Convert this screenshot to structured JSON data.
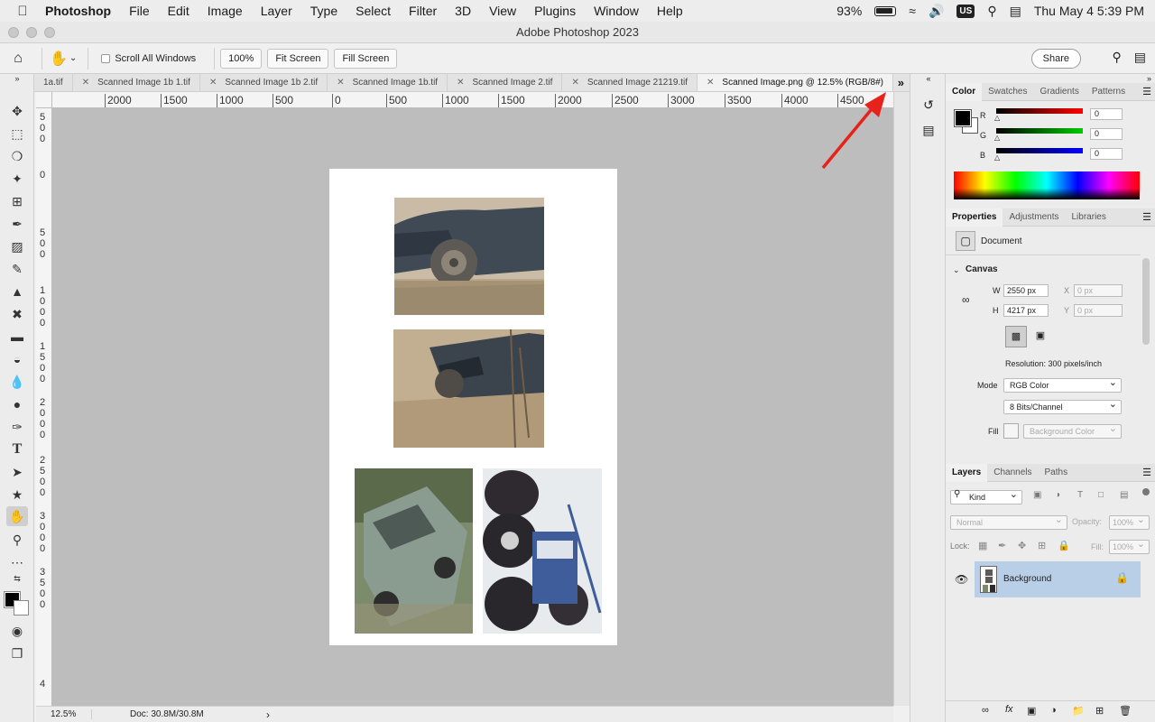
{
  "menubar": {
    "apple_icon": "apple-logo",
    "items": [
      "Photoshop",
      "File",
      "Edit",
      "Image",
      "Layer",
      "Type",
      "Select",
      "Filter",
      "3D",
      "View",
      "Plugins",
      "Window",
      "Help"
    ],
    "battery": "93%",
    "input_source": "US",
    "datetime": "Thu May 4  5:39 PM"
  },
  "window": {
    "title": "Adobe Photoshop 2023"
  },
  "options": {
    "scroll_all_label": "Scroll All Windows",
    "zoom_btn": "100%",
    "fit_screen": "Fit Screen",
    "fill_screen": "Fill Screen",
    "share": "Share"
  },
  "tabs": [
    {
      "label": "1a.tif",
      "active": false
    },
    {
      "label": "Scanned Image 1b 1.tif",
      "active": false
    },
    {
      "label": "Scanned Image 1b 2.tif",
      "active": false
    },
    {
      "label": "Scanned Image 1b.tif",
      "active": false
    },
    {
      "label": "Scanned Image 2.tif",
      "active": false
    },
    {
      "label": "Scanned Image 21219.tif",
      "active": false
    },
    {
      "label": "Scanned Image.png @ 12.5% (RGB/8#)",
      "active": true
    }
  ],
  "ruler_h": [
    "2000",
    "1500",
    "1000",
    "500",
    "0",
    "500",
    "1000",
    "1500",
    "2000",
    "2500",
    "3000",
    "3500",
    "4000",
    "4500"
  ],
  "ruler_v": [
    "500",
    "0",
    "500",
    "1000",
    "1500",
    "2000",
    "2500",
    "3000",
    "3500",
    "4"
  ],
  "status": {
    "zoom": "12.5%",
    "doc": "Doc: 30.8M/30.8M"
  },
  "color_panel": {
    "tabs": [
      "Color",
      "Swatches",
      "Gradients",
      "Patterns"
    ],
    "channels": [
      {
        "label": "R",
        "value": "0",
        "color": "#ff0000"
      },
      {
        "label": "G",
        "value": "0",
        "color": "#00cc00"
      },
      {
        "label": "B",
        "value": "0",
        "color": "#0000ff"
      }
    ]
  },
  "properties": {
    "tabs": [
      "Properties",
      "Adjustments",
      "Libraries"
    ],
    "doc_label": "Document",
    "section": "Canvas",
    "w_label": "W",
    "w": "2550 px",
    "h_label": "H",
    "h": "4217 px",
    "x_label": "X",
    "x": "0 px",
    "y_label": "Y",
    "y": "0 px",
    "resolution": "Resolution: 300 pixels/inch",
    "mode_label": "Mode",
    "mode": "RGB Color",
    "bits": "8 Bits/Channel",
    "fill_label": "Fill",
    "fill": "Background Color"
  },
  "layers": {
    "tabs": [
      "Layers",
      "Channels",
      "Paths"
    ],
    "kind": "Kind",
    "blend": "Normal",
    "opacity_label": "Opacity:",
    "opacity": "100%",
    "lock_label": "Lock:",
    "fill_label": "Fill:",
    "fill": "100%",
    "layer_name": "Background"
  },
  "accent": "#b9cfe8"
}
